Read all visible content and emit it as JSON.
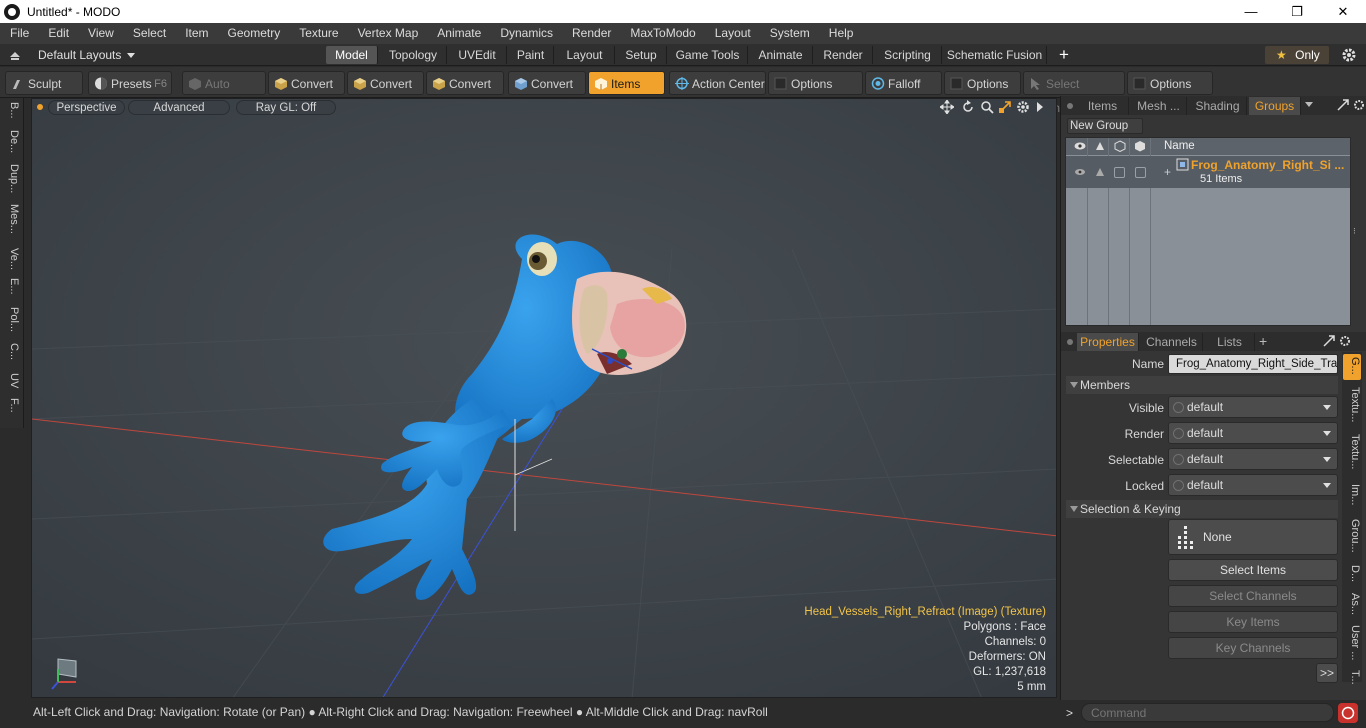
{
  "window": {
    "title": "Untitled* - MODO",
    "minimize": "—",
    "maximize": "❐",
    "close": "✕"
  },
  "menu": [
    "File",
    "Edit",
    "View",
    "Select",
    "Item",
    "Geometry",
    "Texture",
    "Vertex Map",
    "Animate",
    "Dynamics",
    "Render",
    "MaxToModo",
    "Layout",
    "System",
    "Help"
  ],
  "layouts": {
    "default_layouts": "Default Layouts",
    "tabs": [
      "Model",
      "Topology",
      "UVEdit",
      "Paint",
      "Layout",
      "Setup",
      "Game Tools",
      "Animate",
      "Render",
      "Scripting",
      "Schematic Fusion"
    ],
    "active_tab": "Model",
    "add": "+",
    "only": "Only"
  },
  "toolbar": {
    "sculpt": "Sculpt",
    "presets": "Presets",
    "presets_key": "F6",
    "auto_select": "Auto Select",
    "convert1": "Convert",
    "convert2": "Convert",
    "convert3": "Convert",
    "convert4": "Convert",
    "items": "Items",
    "action_center": "Action Center",
    "options1": "Options",
    "falloff": "Falloff",
    "options2": "Options",
    "select_through": "Select Through",
    "options3": "Options"
  },
  "left_tabs": [
    "B...",
    "De...",
    "Dup...",
    "Mes...",
    "Ve...",
    "E...",
    "Pol...",
    "C...",
    "UV",
    "F..."
  ],
  "viewport": {
    "perspective": "Perspective",
    "advanced": "Advanced",
    "raygl": "Ray GL: Off",
    "info_texture": "Head_Vessels_Right_Refract (Image) (Texture)",
    "info_polygons": "Polygons : Face",
    "info_channels": "Channels: 0",
    "info_deformers": "Deformers: ON",
    "info_gl": "GL: 1,237,618",
    "info_scale": "5 mm"
  },
  "status_bar": "Alt-Left Click and Drag: Navigation: Rotate (or Pan) ● Alt-Right Click and Drag: Navigation: Freewheel ● Alt-Middle Click and Drag: navRoll",
  "groups_panel": {
    "tabs": [
      "Items",
      "Mesh ...",
      "Shading",
      "Groups"
    ],
    "active_tab": "Groups",
    "new_group": "New Group",
    "name_header": "Name",
    "group_name": "Frog_Anatomy_Right_Si ...",
    "group_count": "51 Items"
  },
  "properties_panel": {
    "tabs": [
      "Properties",
      "Channels",
      "Lists"
    ],
    "active_tab": "Properties",
    "add": "+",
    "name_label": "Name",
    "name_value": "Frog_Anatomy_Right_Side_Trans",
    "members_section": "Members",
    "visible_label": "Visible",
    "visible_value": "default",
    "render_label": "Render",
    "render_value": "default",
    "selectable_label": "Selectable",
    "selectable_value": "default",
    "locked_label": "Locked",
    "locked_value": "default",
    "selection_section": "Selection & Keying",
    "none_label": "None",
    "select_items": "Select Items",
    "select_channels": "Select Channels",
    "key_items": "Key Items",
    "key_channels": "Key Channels",
    "more": ">>"
  },
  "right_tabs": [
    "G...",
    "Textu...",
    "Textu...",
    "Im...",
    "Grou...",
    "D...",
    "As...",
    "User ...",
    "T..."
  ],
  "command": {
    "placeholder": "Command",
    "prompt": ">"
  },
  "colors": {
    "accent": "#f0a22c",
    "frog_blue": "#1f86d6",
    "viewport_bg": "#3d4349"
  }
}
